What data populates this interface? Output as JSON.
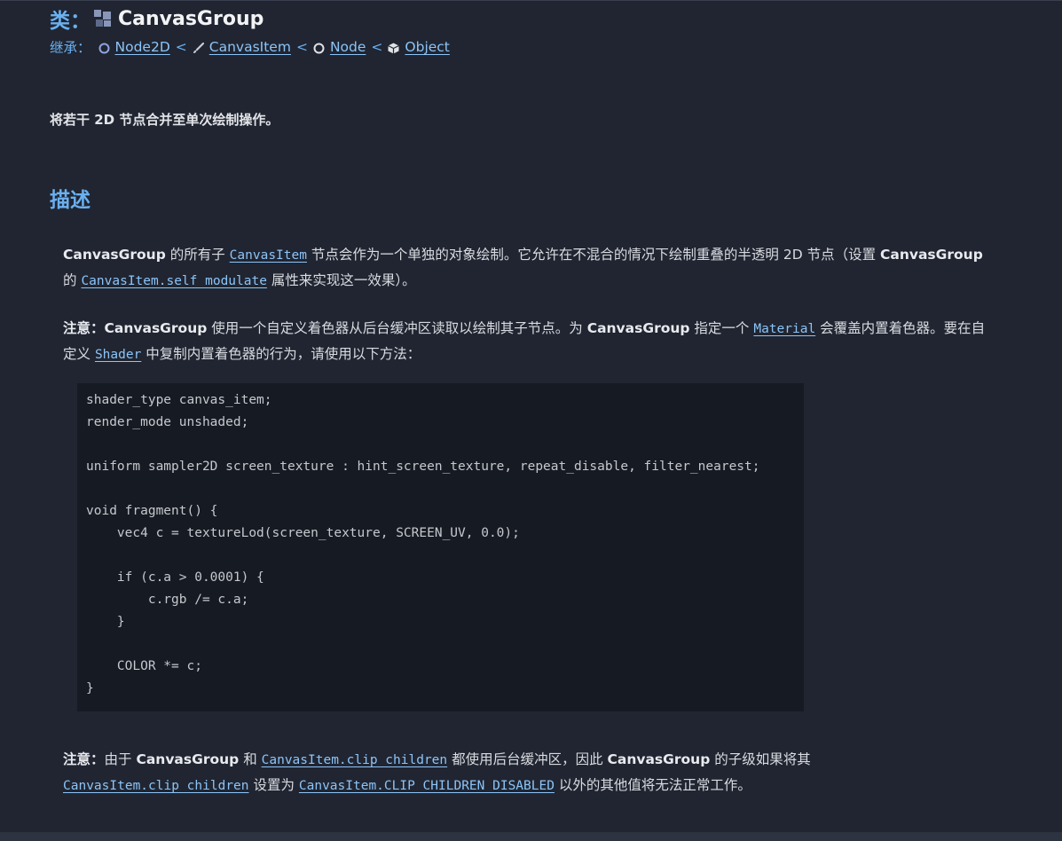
{
  "header": {
    "class_label": "类：",
    "class_name": "CanvasGroup",
    "class_icon": "canvas-group-icon",
    "inherits_label": "继承：",
    "inheritance": [
      {
        "name": "Node2D",
        "icon": "node2d-circle-icon"
      },
      {
        "name": "CanvasItem",
        "icon": "brush-icon"
      },
      {
        "name": "Node",
        "icon": "node-circle-icon"
      },
      {
        "name": "Object",
        "icon": "cube-icon"
      }
    ],
    "separator": "<"
  },
  "brief": "将若干 2D 节点合并至单次绘制操作。",
  "description": {
    "heading": "描述",
    "p1": {
      "s1": "CanvasGroup",
      "s2": " 的所有子 ",
      "s3": "CanvasItem",
      "s4": " 节点会作为一个单独的对象绘制。它允许在不混合的情况下绘制重叠的半透明 2D 节点（设置 ",
      "s5": "CanvasGroup",
      "s6": " 的 ",
      "s7": "CanvasItem.self_modulate",
      "s8": " 属性来实现这一效果）。"
    },
    "p2": {
      "s1": "注意：",
      "s2": "CanvasGroup",
      "s3": " 使用一个自定义着色器从后台缓冲区读取以绘制其子节点。为 ",
      "s4": "CanvasGroup",
      "s5": " 指定一个 ",
      "s6": "Material",
      "s7": " 会覆盖内置着色器。要在自定义 ",
      "s8": "Shader",
      "s9": " 中复制内置着色器的行为，请使用以下方法："
    },
    "code": "shader_type canvas_item;\nrender_mode unshaded;\n\nuniform sampler2D screen_texture : hint_screen_texture, repeat_disable, filter_nearest;\n\nvoid fragment() {\n    vec4 c = textureLod(screen_texture, SCREEN_UV, 0.0);\n\n    if (c.a > 0.0001) {\n        c.rgb /= c.a;\n    }\n\n    COLOR *= c;\n}",
    "p3": {
      "s1": "注意：",
      "s2": "由于 ",
      "s3": "CanvasGroup",
      "s4": " 和 ",
      "s5": "CanvasItem.clip_children",
      "s6": " 都使用后台缓冲区，因此 ",
      "s7": "CanvasGroup",
      "s8": " 的子级如果将其",
      "s9": "CanvasItem.clip_children",
      "s10": " 设置为 ",
      "s11": "CanvasItem.CLIP_CHILDREN_DISABLED",
      "s12": " 以外的其他值将无法正常工作。"
    }
  },
  "colors": {
    "background": "#202531",
    "accent": "#6ab0f0",
    "link": "#8cc4f8",
    "code_background": "#161a22"
  }
}
